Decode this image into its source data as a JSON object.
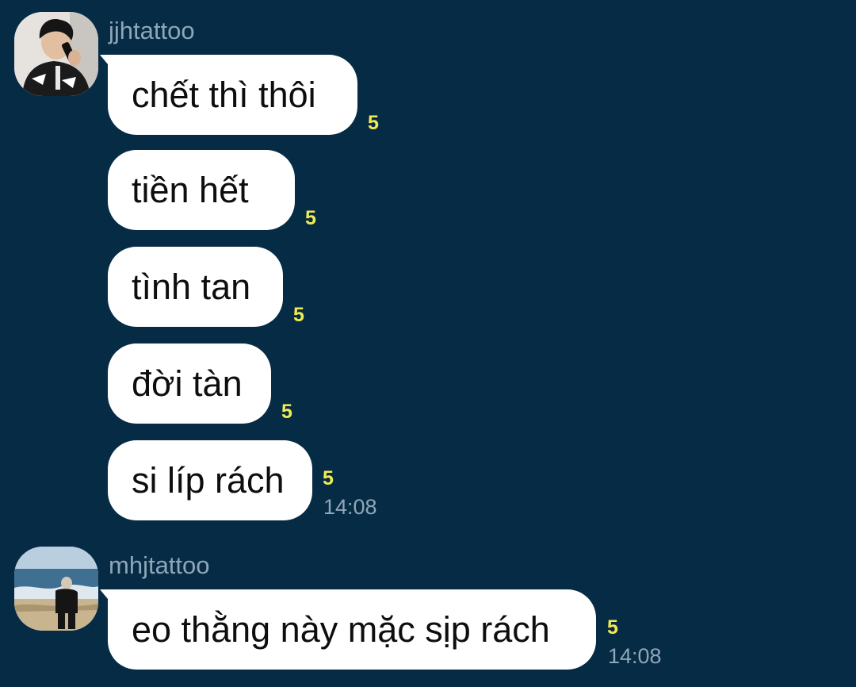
{
  "groups": [
    {
      "sender": "jjhtattoo",
      "avatar_icon": "person-on-phone-avatar",
      "messages": [
        {
          "text": "chết thì thôi",
          "reaction": "5"
        },
        {
          "text": "tiền hết",
          "reaction": "5"
        },
        {
          "text": "tình tan",
          "reaction": "5"
        },
        {
          "text": "đời tàn",
          "reaction": "5"
        },
        {
          "text": "si líp rách",
          "reaction": "5",
          "time": "14:08"
        }
      ]
    },
    {
      "sender": "mhjtattoo",
      "avatar_icon": "person-at-beach-avatar",
      "messages": [
        {
          "text": "eo thằng này mặc sịp rách",
          "reaction": "5",
          "time": "14:08"
        }
      ]
    }
  ],
  "colors": {
    "background": "#062b44",
    "bubble": "#ffffff",
    "reaction": "#f3ea52",
    "meta_text": "#8fa6b8"
  }
}
